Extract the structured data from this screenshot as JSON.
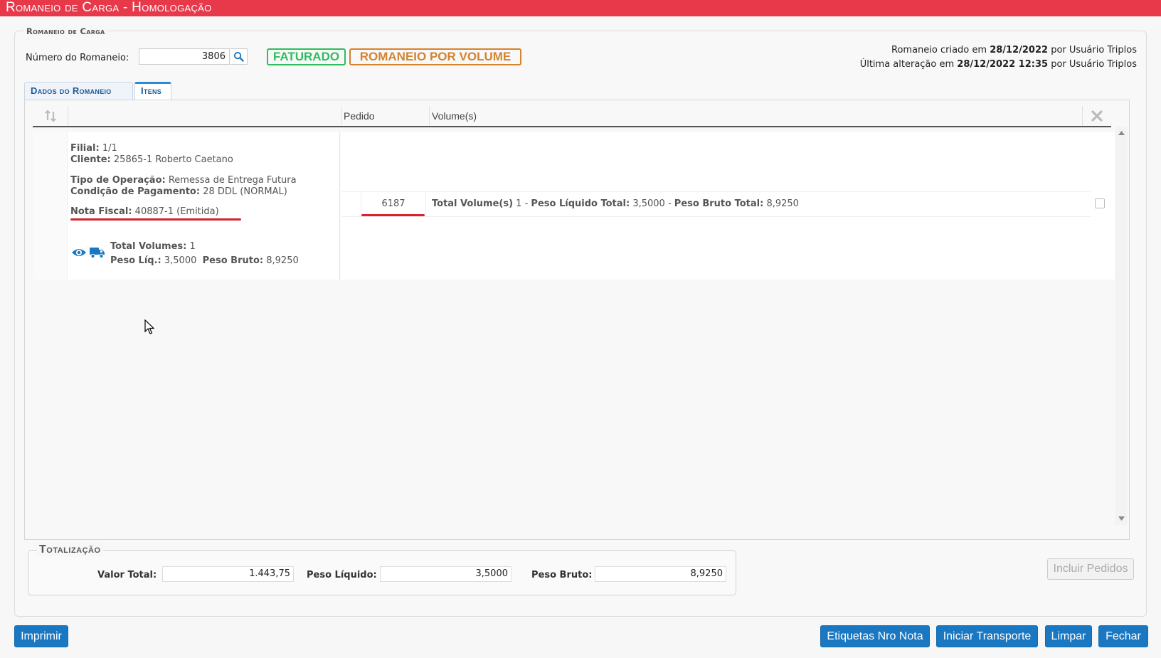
{
  "window": {
    "title": "Romaneio de Carga  - Homologação"
  },
  "form": {
    "legend": "Romaneio de Carga",
    "numero_label": "Número do Romaneio:",
    "numero_value": "3806",
    "status_badge": "FATURADO",
    "type_badge": "ROMANEIO POR VOLUME",
    "created": {
      "prefix": "Romaneio criado em",
      "date": "28/12/2022",
      "suffix": "por Usuário Triplos"
    },
    "updated": {
      "prefix": "Última alteração em",
      "date": "28/12/2022 12:35",
      "suffix": "por Usuário Triplos"
    }
  },
  "tabs": [
    {
      "label": "Dados do Romaneio",
      "active": false
    },
    {
      "label": "Itens",
      "active": true
    }
  ],
  "grid": {
    "headers": {
      "pedido": "Pedido",
      "volumes": "Volume(s)"
    },
    "rows": [
      {
        "filial_label": "Filial:",
        "filial": "1/1",
        "cliente_label": "Cliente:",
        "cliente": "25865-1 Roberto Caetano",
        "tipo_label": "Tipo de Operação:",
        "tipo": "Remessa de Entrega Futura",
        "cond_label": "Condição de Pagamento:",
        "cond": "28 DDL (NORMAL)",
        "nota_label": "Nota Fiscal:",
        "nota": "40887-1 (Emitida)",
        "total_vol_label": "Total Volumes:",
        "total_vol": "1",
        "peso_liq_label": "Peso Líq.:",
        "peso_liq": "3,5000",
        "peso_bruto_label": "Peso Bruto:",
        "peso_bruto": "8,9250",
        "pedido": "6187",
        "vol_summary": {
          "label1": "Total Volume(s)",
          "val1": "1 -",
          "label2": "Peso Líquido Total:",
          "val2": "3,5000 -",
          "label3": "Peso Bruto Total:",
          "val3": "8,9250"
        }
      }
    ]
  },
  "totalizacao": {
    "legend": "Totalização",
    "valor_total_label": "Valor Total:",
    "valor_total": "1.443,75",
    "peso_liquido_label": "Peso Líquido:",
    "peso_liquido": "3,5000",
    "peso_bruto_label": "Peso Bruto:",
    "peso_bruto": "8,9250"
  },
  "buttons": {
    "incluir_pedidos": "Incluir Pedidos",
    "imprimir": "Imprimir",
    "etiquetas": "Etiquetas Nro Nota",
    "iniciar_transporte": "Iniciar Transporte",
    "limpar": "Limpar",
    "fechar": "Fechar"
  },
  "colors": {
    "titlebar": "#e8394a",
    "primary": "#1a78c2",
    "status_green": "#2ebd5f",
    "type_orange": "#d4832e",
    "underline": "#d8232a"
  },
  "icons": [
    "search-icon",
    "sort-icon",
    "clear-icon",
    "eye-icon",
    "truck-icon",
    "cursor-icon"
  ]
}
